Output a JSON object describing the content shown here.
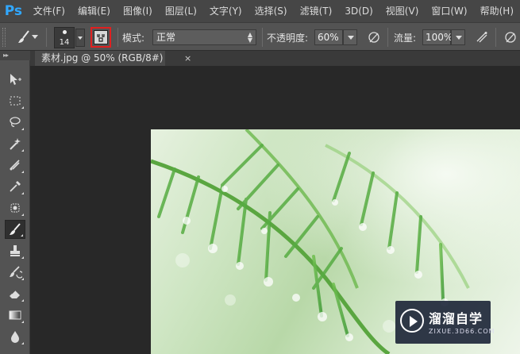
{
  "app": {
    "logo": "Ps",
    "accent": "#31a8ff"
  },
  "menu": [
    "文件(F)",
    "编辑(E)",
    "图像(I)",
    "图层(L)",
    "文字(Y)",
    "选择(S)",
    "滤镜(T)",
    "3D(D)",
    "视图(V)",
    "窗口(W)",
    "帮助(H)"
  ],
  "options": {
    "tool_preset_icon": "brush-icon",
    "brush_size": "14",
    "toggle_brush_panel_icon": "brush-panel-icon",
    "mode_label": "模式:",
    "mode_value": "正常",
    "opacity_label": "不透明度:",
    "opacity_value": "60%",
    "flow_label": "流量:",
    "flow_value": "100%",
    "highlight_color": "#e02020"
  },
  "tools": [
    "move-icon",
    "marquee-icon",
    "lasso-icon",
    "magic-wand-icon",
    "crop-icon",
    "eyedropper-icon",
    "spot-healing-icon",
    "brush-icon",
    "clone-stamp-icon",
    "history-brush-icon",
    "eraser-icon",
    "gradient-icon",
    "blur-icon"
  ],
  "active_tool": "brush-icon",
  "document": {
    "tab_title": "素材.jpg @ 50% (RGB/8#)",
    "close_glyph": "×"
  },
  "watermark": {
    "title": "溜溜自学",
    "url": "ZIXUE.3D66.COM"
  }
}
